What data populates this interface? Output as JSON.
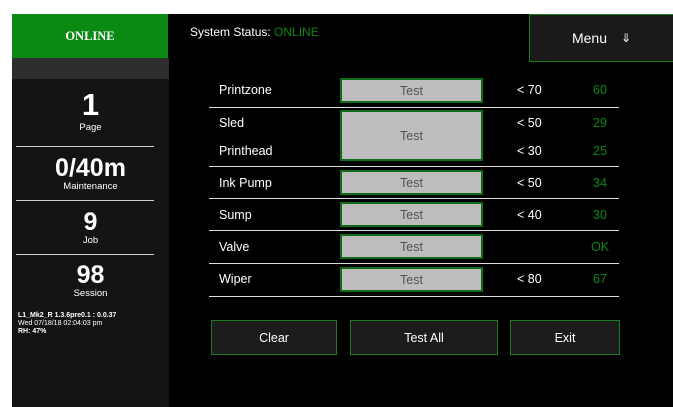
{
  "sidebar": {
    "online_label": "ONLINE",
    "page": {
      "value": "1",
      "label": "Page"
    },
    "maintenance": {
      "value": "0/40m",
      "label": "Maintenance"
    },
    "job": {
      "value": "9",
      "label": "Job"
    },
    "session": {
      "value": "98",
      "label": "Session"
    },
    "version": "L1_Mk2_R 1.3.6pre0.1 : 0.0.37",
    "datetime": "Wed 07/18/18 02:04:03 pm",
    "humidity": "RH: 47%"
  },
  "header": {
    "status_label": "System Status:",
    "status_value": "ONLINE",
    "menu_label": "Menu",
    "menu_icon": "⇓"
  },
  "tests": [
    {
      "name": "Printzone",
      "button": "Test",
      "limit": "< 70",
      "reading": "60"
    },
    {
      "name": "Sled",
      "button": "Test",
      "limit": "< 50",
      "reading": "29"
    },
    {
      "name": "Printhead",
      "limit": "< 30",
      "reading": "25"
    },
    {
      "name": "Ink Pump",
      "button": "Test",
      "limit": "< 50",
      "reading": "34"
    },
    {
      "name": "Sump",
      "button": "Test",
      "limit": "< 40",
      "reading": "30"
    },
    {
      "name": "Valve",
      "button": "Test",
      "limit": "",
      "reading": "OK"
    },
    {
      "name": "Wiper",
      "button": "Test",
      "limit": "< 80",
      "reading": "67"
    }
  ],
  "actions": {
    "clear": "Clear",
    "test_all": "Test All",
    "exit": "Exit"
  },
  "colors": {
    "accent_green": "#0a8a12",
    "background": "#000000",
    "button_gray": "#bdbdbd"
  }
}
